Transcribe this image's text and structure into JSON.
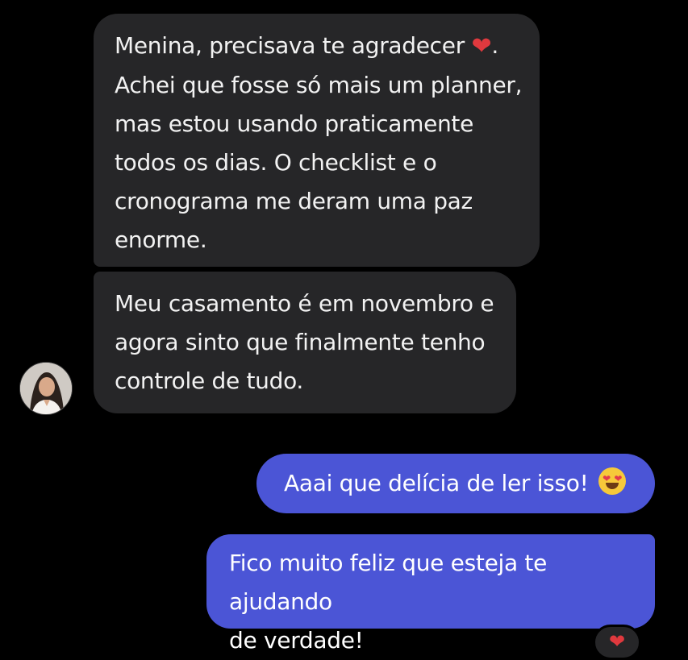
{
  "colors": {
    "background": "#000000",
    "incoming_bubble": "#262628",
    "outgoing_bubble": "#4b55d6",
    "heart": "#e0393e"
  },
  "conversation": {
    "messages": [
      {
        "direction": "incoming",
        "text_before_emoji": "Menina, precisava te agradecer ",
        "emoji": "heart",
        "text_after_emoji": ".\nAchei que fosse só mais um planner,\nmas estou usando praticamente\ntodos os dias. O checklist e o\ncronograma me deram uma paz\nenorme."
      },
      {
        "direction": "incoming",
        "text": "Meu casamento é em novembro e\nagora sinto que finalmente tenho\ncontrole de tudo."
      },
      {
        "direction": "outgoing",
        "text": "Aaai que delícia de ler isso! ",
        "emoji": "heart-eyes-face"
      },
      {
        "direction": "outgoing",
        "text": "Fico muito feliz que esteja te ajudando\nde verdade!",
        "reaction": "heart"
      }
    ]
  },
  "icons": {
    "heart": "❤",
    "avatar": "contact-avatar"
  }
}
